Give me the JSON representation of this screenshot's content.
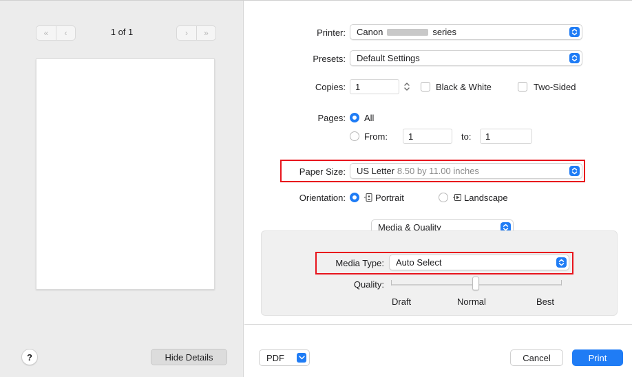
{
  "preview": {
    "page_count": "1 of 1",
    "first_label": "«",
    "prev_label": "‹",
    "next_label": "›",
    "last_label": "»",
    "help_label": "?",
    "hide_details_label": "Hide Details"
  },
  "printer": {
    "label": "Printer:",
    "name_prefix": "Canon",
    "name_suffix": "series"
  },
  "presets": {
    "label": "Presets:",
    "value": "Default Settings"
  },
  "copies": {
    "label": "Copies:",
    "value": "1",
    "black_white_label": "Black & White",
    "black_white_checked": false,
    "two_sided_label": "Two-Sided",
    "two_sided_checked": false
  },
  "pages": {
    "label": "Pages:",
    "all_label": "All",
    "all_selected": true,
    "from_label": "From:",
    "from_value": "1",
    "to_label": "to:",
    "to_value": "1"
  },
  "paper_size": {
    "label": "Paper Size:",
    "value": "US Letter",
    "detail": "8.50 by 11.00 inches"
  },
  "orientation": {
    "label": "Orientation:",
    "portrait_label": "Portrait",
    "landscape_label": "Landscape",
    "selected": "portrait"
  },
  "section_popup": {
    "value": "Media & Quality"
  },
  "media_type": {
    "label": "Media Type:",
    "value": "Auto Select"
  },
  "quality": {
    "label": "Quality:",
    "draft_label": "Draft",
    "normal_label": "Normal",
    "best_label": "Best",
    "level": "Normal"
  },
  "footer": {
    "pdf_label": "PDF",
    "cancel_label": "Cancel",
    "print_label": "Print"
  },
  "colors": {
    "accent": "#1f7cf5",
    "highlight": "#e8141c"
  }
}
